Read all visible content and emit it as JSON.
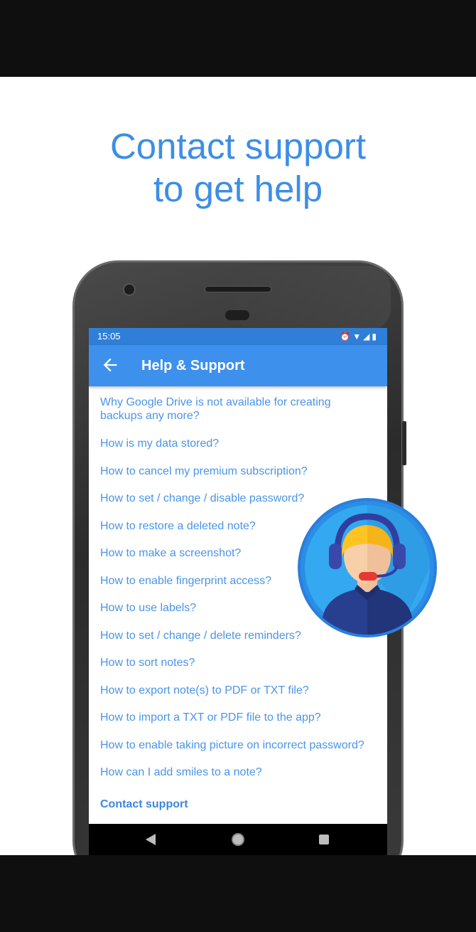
{
  "headline": {
    "line1": "Contact support",
    "line2": "to get help"
  },
  "status_bar": {
    "time": "15:05",
    "icons": [
      "alarm-icon",
      "wifi-icon",
      "signal-icon",
      "battery-icon"
    ]
  },
  "app_bar": {
    "title": "Help & Support",
    "back_icon": "arrow-left-icon"
  },
  "faq": [
    "Why Google Drive is not available for creating backups any more?",
    "How is my data stored?",
    "How to cancel my premium subscription?",
    "How to set / change / disable password?",
    "How to restore a deleted note?",
    "How to make a screenshot?",
    "How to enable fingerprint access?",
    "How to use labels?",
    "How to set / change / delete reminders?",
    "How to sort notes?",
    "How to export note(s) to PDF or TXT file?",
    "How to import a TXT or PDF file to the app?",
    "How to enable taking picture on incorrect password?",
    "How can I add smiles to a note?"
  ],
  "contact_link": "Contact support",
  "colors": {
    "accent": "#3d90ec",
    "link": "#4a94e8",
    "headline": "#3d8ee6"
  }
}
